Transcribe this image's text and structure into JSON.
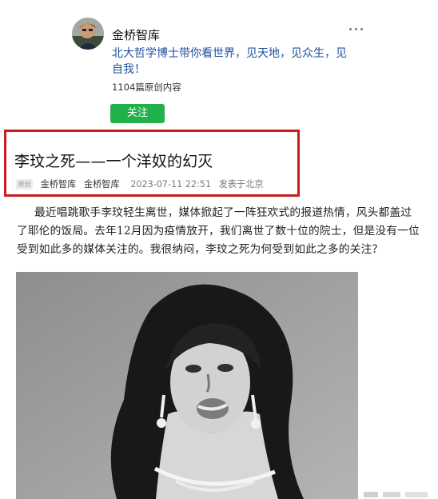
{
  "profile": {
    "name": "金桥智库",
    "bio": "北大哲学博士带你看世界，见天地，见众生，见自我！",
    "article_count": "1104篇原创内容",
    "follow_label": "关注",
    "avatar_icon": "person-avatar",
    "more_icon": "more-dots-icon"
  },
  "article": {
    "title": "李玟之死——一个洋奴的幻灭",
    "meta": {
      "original_badge": "原创",
      "author": "金桥智库",
      "account": "金桥智库",
      "datetime": "2023-07-11 22:51",
      "location": "发表于北京"
    },
    "intro": "最近唱跳歌手李玟轻生离世，媒体掀起了一阵狂欢式的报道热情，风头都盖过了耶伦的饭局。去年12月因为疫情放开，我们离世了数十位的院士，但是没有一位受到如此多的媒体关注的。我很纳闷，李玟之死为何受到如此之多的关注？"
  },
  "image": {
    "description_icon": "photo-portrait"
  },
  "colors": {
    "highlight_box": "#c81e1e",
    "follow_button": "#20b14a",
    "bio_text": "#1f4f9e"
  }
}
